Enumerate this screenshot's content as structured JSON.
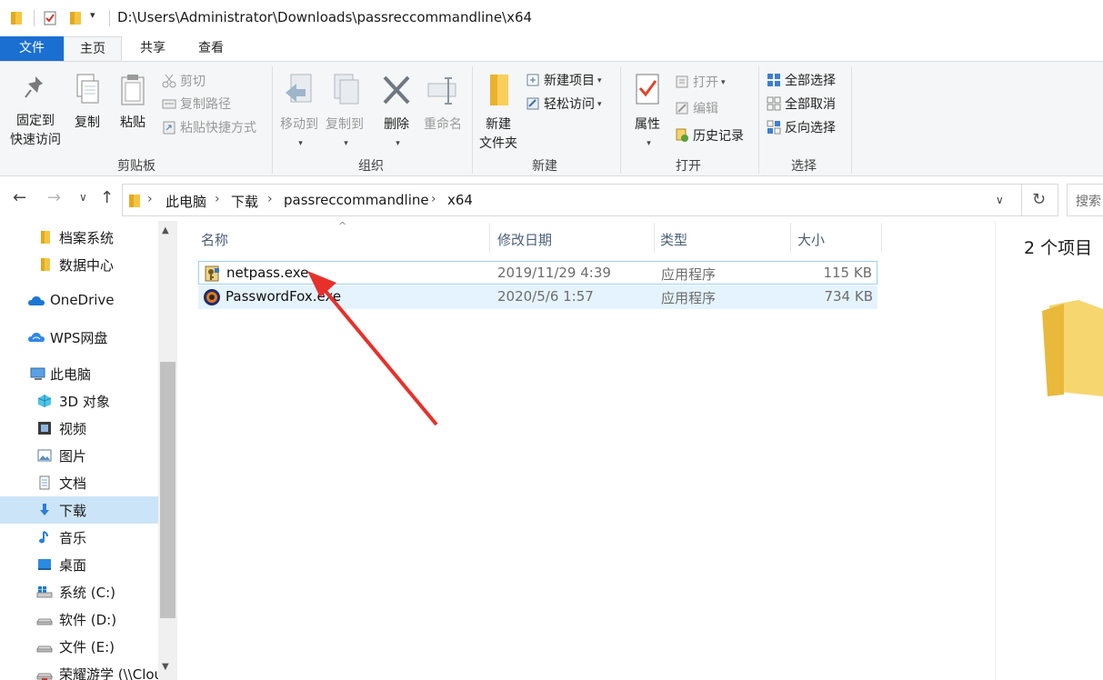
{
  "titlebar": {
    "path": "D:\\Users\\Administrator\\Downloads\\passreccommandline\\x64",
    "quick_access_dropdown": "▾"
  },
  "tabs": [
    "文件",
    "主页",
    "共享",
    "查看"
  ],
  "ribbon": {
    "clipboard": {
      "pin": [
        "固定到",
        "快速访问"
      ],
      "copy": "复制",
      "paste": "粘贴",
      "cut": "剪切",
      "copy_path": "复制路径",
      "paste_shortcut": "粘贴快捷方式",
      "group_label": "剪贴板"
    },
    "organize": {
      "move_to": "移动到",
      "copy_to": "复制到",
      "delete": "删除",
      "rename": "重命名",
      "group_label": "组织"
    },
    "new": {
      "new_folder": [
        "新建",
        "文件夹"
      ],
      "new_item": "新建项目",
      "easy_access": "轻松访问",
      "group_label": "新建"
    },
    "open": {
      "properties": "属性",
      "open": "打开",
      "edit": "编辑",
      "history": "历史记录",
      "group_label": "打开"
    },
    "select": {
      "select_all": "全部选择",
      "select_none": "全部取消",
      "invert": "反向选择",
      "group_label": "选择"
    }
  },
  "address": {
    "crumbs": [
      "此电脑",
      "下载",
      "passreccommandline",
      "x64"
    ],
    "search_placeholder": "搜索"
  },
  "nav_pane": {
    "items": [
      {
        "label": "档案系统",
        "icon": "folder-icon"
      },
      {
        "label": "数据中心",
        "icon": "folder-icon"
      },
      {
        "label": "OneDrive",
        "icon": "cloud-icon"
      },
      {
        "label": "WPS网盘",
        "icon": "cloud-icon"
      },
      {
        "label": "此电脑",
        "icon": "computer-icon"
      },
      {
        "label": "3D 对象",
        "icon": "3d-objects-icon"
      },
      {
        "label": "视频",
        "icon": "video-icon"
      },
      {
        "label": "图片",
        "icon": "pictures-icon"
      },
      {
        "label": "文档",
        "icon": "documents-icon"
      },
      {
        "label": "下载",
        "icon": "download-icon",
        "selected": true
      },
      {
        "label": "音乐",
        "icon": "music-icon"
      },
      {
        "label": "桌面",
        "icon": "desktop-icon"
      },
      {
        "label": "系统 (C:)",
        "icon": "windows-drive-icon"
      },
      {
        "label": "软件 (D:)",
        "icon": "drive-icon"
      },
      {
        "label": "文件 (E:)",
        "icon": "drive-icon"
      },
      {
        "label": "荣耀游学 (\\\\Clou",
        "icon": "network-drive-icon"
      }
    ]
  },
  "file_list": {
    "columns": [
      "名称",
      "修改日期",
      "类型",
      "大小"
    ],
    "rows": [
      {
        "name": "netpass.exe",
        "modified": "2019/11/29 4:39",
        "type": "应用程序",
        "size": "115 KB",
        "icon": "netpass-exe-icon"
      },
      {
        "name": "PasswordFox.exe",
        "modified": "2020/5/6 1:57",
        "type": "应用程序",
        "size": "734 KB",
        "icon": "passwordfox-exe-icon"
      }
    ]
  },
  "preview": {
    "item_count": "2 个项目"
  },
  "colors": {
    "file_tab_bg": "#1a6fd1",
    "selected_nav_bg": "#cce4f7",
    "hover_row_bg": "#e5f3ff",
    "annotation_arrow": "#e8302a"
  }
}
